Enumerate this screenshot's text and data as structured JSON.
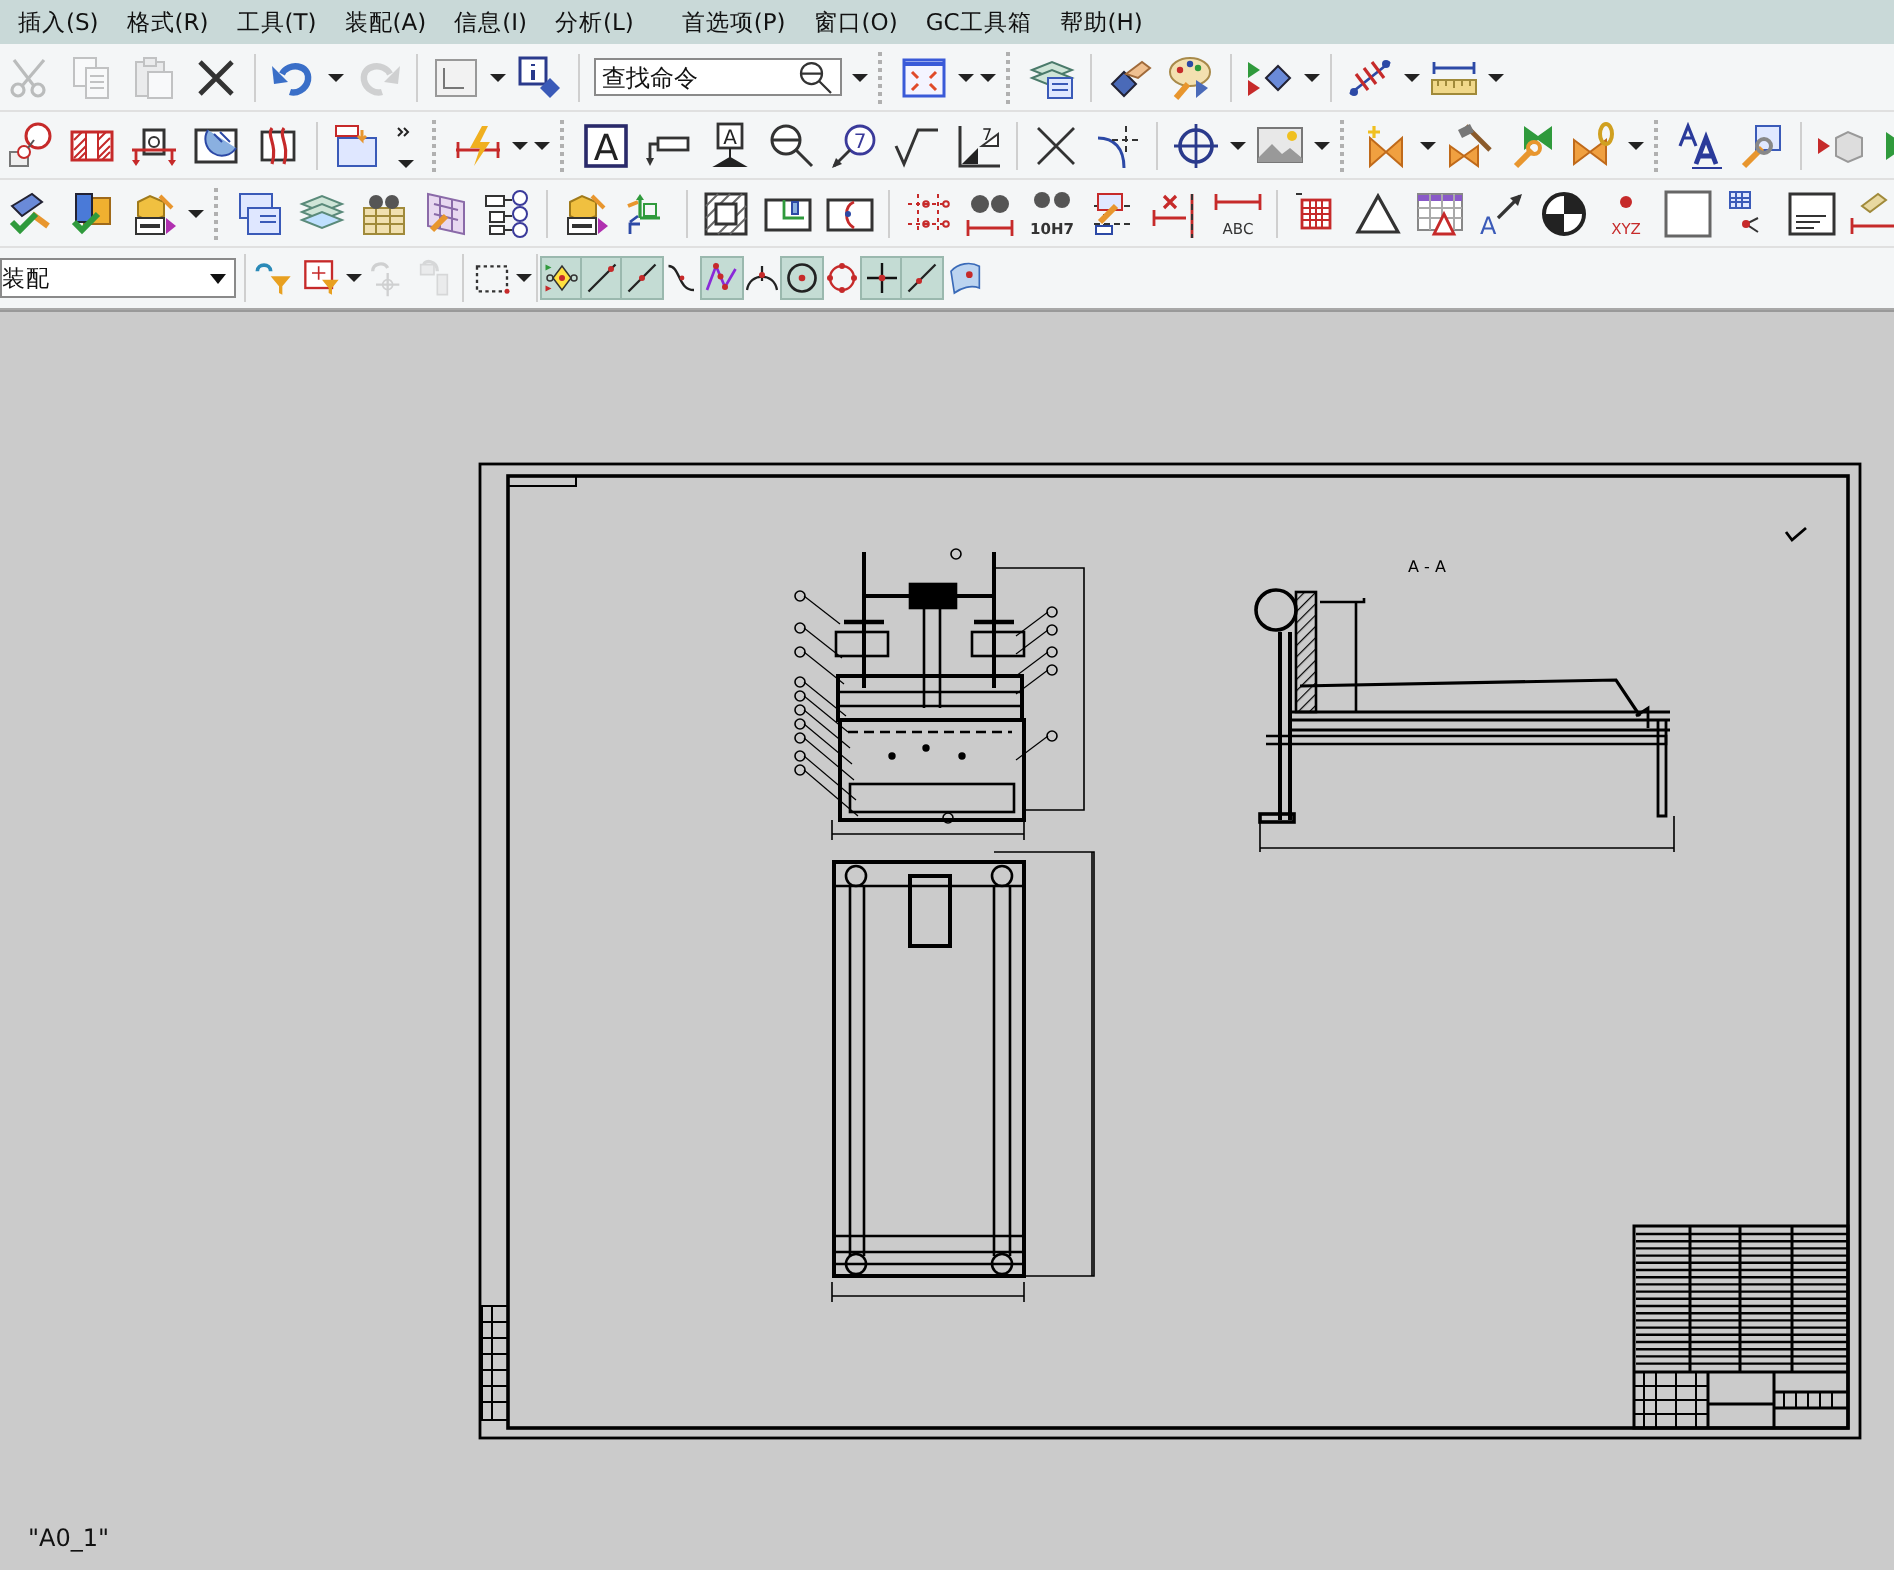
{
  "menu_bar": [
    {
      "label": "插入(S)"
    },
    {
      "label": "格式(R)"
    },
    {
      "label": "工具(T)"
    },
    {
      "label": "装配(A)"
    },
    {
      "label": "信息(I)"
    },
    {
      "label": "分析(L)"
    },
    {
      "label": "首选项(P)"
    },
    {
      "label": "窗口(O)"
    },
    {
      "label": "GC工具箱"
    },
    {
      "label": "帮助(H)"
    }
  ],
  "toolbars": {
    "edit_tools": [
      {
        "disabled": true
      },
      {
        "disabled": true
      },
      {
        "disabled": true
      },
      {
        "disabled": false
      }
    ],
    "history_tools": [
      {
        "disabled": false
      },
      {
        "disabled": true
      }
    ],
    "search": {
      "placeholder": "查找命令"
    },
    "icon_texts": [
      "A",
      "A",
      "7",
      "7",
      "10H7",
      "ABC",
      "A",
      "XYZ"
    ],
    "filter": {
      "value": "装配"
    },
    "selection_tools": [
      {
        "disabled": false
      },
      {
        "disabled": false
      },
      {
        "disabled": true
      },
      {
        "disabled": true
      }
    ],
    "snap_points": [
      {
        "on": true
      },
      {
        "on": true
      },
      {
        "on": true
      },
      {
        "on": false
      },
      {
        "on": true
      },
      {
        "on": false
      },
      {
        "on": true
      },
      {
        "on": false
      },
      {
        "on": true
      },
      {
        "on": true
      }
    ]
  },
  "drawing": {
    "view_labels": [
      "A - A"
    ]
  },
  "status_bar": {
    "sheet_name": "\"A0_1\""
  }
}
